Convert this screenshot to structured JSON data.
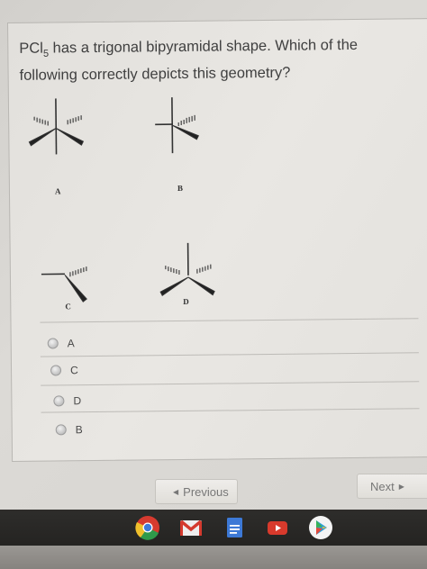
{
  "question": {
    "prefix": "PCl",
    "subscript": "5",
    "suffix": " has a trigonal bipyramidal shape. Which of the following correctly depicts this geometry?"
  },
  "figures": {
    "labels": [
      "A",
      "B",
      "C",
      "D"
    ]
  },
  "options": [
    {
      "label": "A"
    },
    {
      "label": "C"
    },
    {
      "label": "D"
    },
    {
      "label": "B"
    }
  ],
  "nav": {
    "previous_label": "Previous",
    "next_label": "Next"
  },
  "shelf": {
    "apps": [
      "chrome-icon",
      "gmail-icon",
      "docs-icon",
      "youtube-icon",
      "play-store-icon"
    ]
  }
}
